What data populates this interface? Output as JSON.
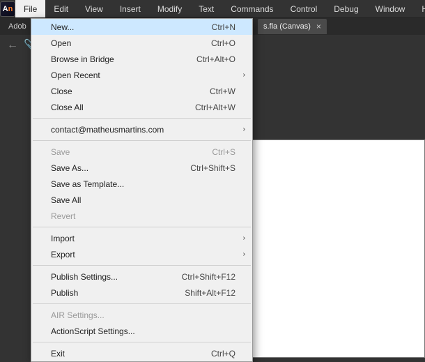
{
  "app": {
    "logoA": "A",
    "logoN": "n",
    "product_prefix": "Adob"
  },
  "menubar": [
    "File",
    "Edit",
    "View",
    "Insert",
    "Modify",
    "Text",
    "Commands",
    "Control",
    "Debug",
    "Window",
    "Help"
  ],
  "tab": {
    "label": "s.fla (Canvas)",
    "close": "×"
  },
  "dropdown": [
    {
      "type": "item",
      "label": "New...",
      "shortcut": "Ctrl+N",
      "hover": true
    },
    {
      "type": "item",
      "label": "Open",
      "shortcut": "Ctrl+O"
    },
    {
      "type": "item",
      "label": "Browse in Bridge",
      "shortcut": "Ctrl+Alt+O"
    },
    {
      "type": "item",
      "label": "Open Recent",
      "submenu": true
    },
    {
      "type": "item",
      "label": "Close",
      "shortcut": "Ctrl+W"
    },
    {
      "type": "item",
      "label": "Close All",
      "shortcut": "Ctrl+Alt+W"
    },
    {
      "type": "sep"
    },
    {
      "type": "item",
      "label": "contact@matheusmartins.com",
      "submenu": true
    },
    {
      "type": "sep"
    },
    {
      "type": "item",
      "label": "Save",
      "shortcut": "Ctrl+S",
      "disabled": true
    },
    {
      "type": "item",
      "label": "Save As...",
      "shortcut": "Ctrl+Shift+S"
    },
    {
      "type": "item",
      "label": "Save as Template..."
    },
    {
      "type": "item",
      "label": "Save All"
    },
    {
      "type": "item",
      "label": "Revert",
      "disabled": true
    },
    {
      "type": "sep"
    },
    {
      "type": "item",
      "label": "Import",
      "submenu": true
    },
    {
      "type": "item",
      "label": "Export",
      "submenu": true
    },
    {
      "type": "sep"
    },
    {
      "type": "item",
      "label": "Publish Settings...",
      "shortcut": "Ctrl+Shift+F12"
    },
    {
      "type": "item",
      "label": "Publish",
      "shortcut": "Shift+Alt+F12"
    },
    {
      "type": "sep"
    },
    {
      "type": "item",
      "label": "AIR Settings...",
      "disabled": true
    },
    {
      "type": "item",
      "label": "ActionScript Settings..."
    },
    {
      "type": "sep"
    },
    {
      "type": "item",
      "label": "Exit",
      "shortcut": "Ctrl+Q"
    }
  ],
  "icons": {
    "back": "←",
    "clip": "📎",
    "chevron": "›"
  }
}
